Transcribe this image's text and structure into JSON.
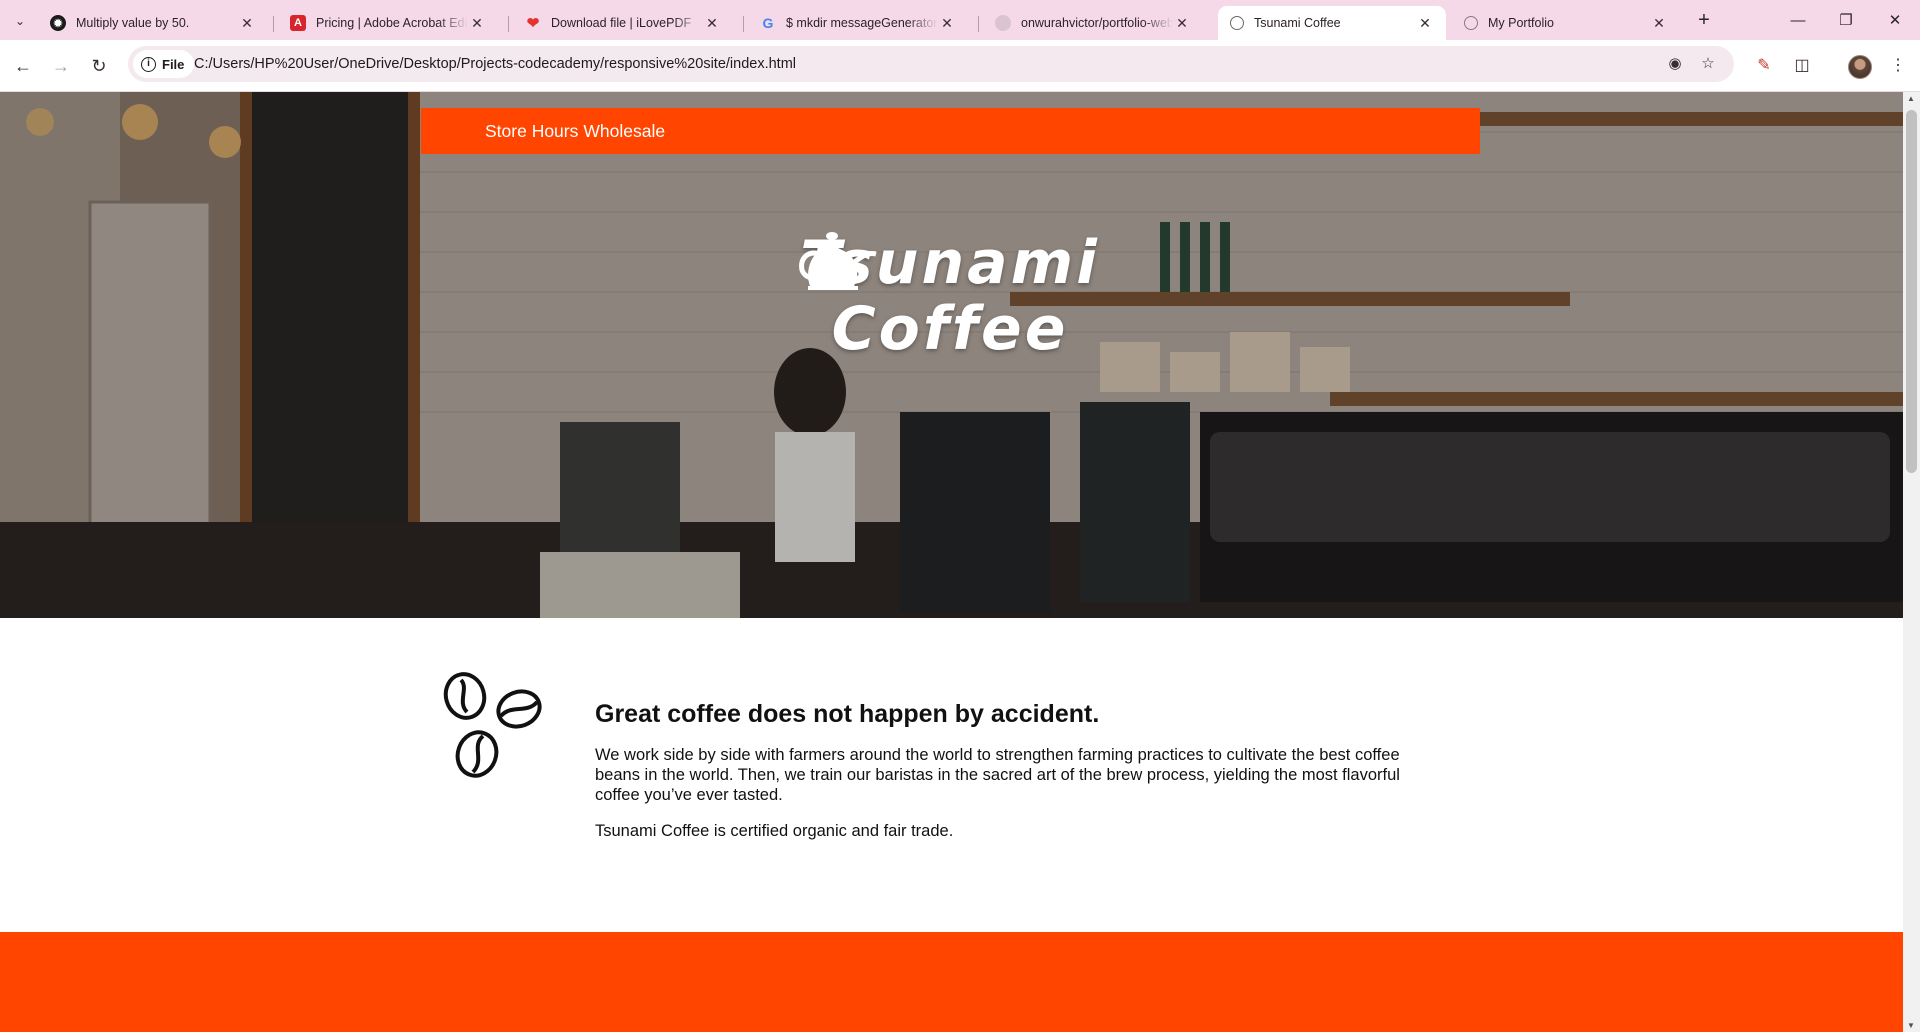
{
  "browser": {
    "tabs": [
      {
        "title": "Multiply value by 50.",
        "favicon": "chatgpt-icon",
        "active": false
      },
      {
        "title": "Pricing | Adobe Acrobat Edit a PDF",
        "favicon": "acrobat-icon",
        "active": false
      },
      {
        "title": "Download file | iLovePDF",
        "favicon": "ilovepdf-heart-icon",
        "active": false
      },
      {
        "title": "$ mkdir messageGenerator mkdir",
        "favicon": "google-g-icon",
        "active": false
      },
      {
        "title": "onwurahvictor/portfolio-website",
        "favicon": "github-icon",
        "active": false
      },
      {
        "title": "Tsunami Coffee",
        "favicon": "globe-icon",
        "active": true
      },
      {
        "title": "My Portfolio",
        "favicon": "globe-icon",
        "active": false
      }
    ],
    "site_chip_label": "File",
    "url": "C:/Users/HP%20User/OneDrive/Desktop/Projects-codecademy/responsive%20site/index.html"
  },
  "page": {
    "nav": {
      "links": [
        "Store Hours",
        "Wholesale"
      ]
    },
    "logo": {
      "line1": "Tsunami",
      "line2": "Coffee"
    },
    "about": {
      "heading": "Great coffee does not happen by accident.",
      "paragraph1": "We work side by side with farmers around the world to strengthen farming practices to cultivate the best coffee beans in the world. Then, we train our baristas in the sacred art of the brew process, yielding the most flavorful coffee you’ve ever tasted.",
      "paragraph2": "Tsunami Coffee is certified organic and fair trade."
    }
  },
  "colors": {
    "brand_orange": "#ff4500",
    "tab_strip": "#f5d9e9",
    "text_dark": "#111111"
  }
}
